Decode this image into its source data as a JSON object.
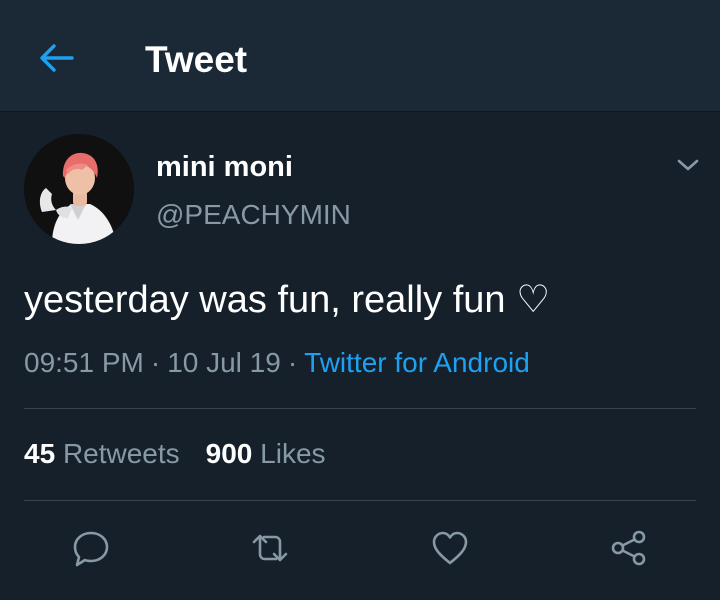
{
  "header": {
    "title": "Tweet",
    "back_icon": "arrow-left-icon"
  },
  "tweet": {
    "author": {
      "name": "mini moni",
      "handle": "@PEACHYMIN",
      "avatar": "profile-photo"
    },
    "text": "yesterday was fun, really fun ♡",
    "time": "09:51 PM",
    "date": "10 Jul 19",
    "meta_separator": "·",
    "source": "Twitter for Android",
    "stats": {
      "retweets_count": "45",
      "retweets_label": "Retweets",
      "likes_count": "900",
      "likes_label": "Likes"
    },
    "actions": [
      "reply-icon",
      "retweet-icon",
      "like-icon",
      "share-icon"
    ]
  },
  "colors": {
    "background": "#15202b",
    "header_background": "#1b2836",
    "accent": "#1da1f2",
    "secondary_text": "#8899a6",
    "divider": "#38444d"
  }
}
